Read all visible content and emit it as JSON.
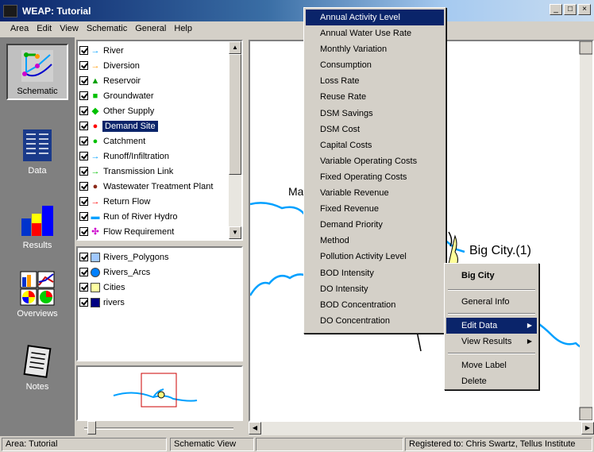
{
  "window": {
    "title": "WEAP: Tutorial",
    "minimize": "_",
    "maximize": "□",
    "close": "×"
  },
  "menubar": [
    "Area",
    "Edit",
    "View",
    "Schematic",
    "General",
    "Help"
  ],
  "leftbar": {
    "schematic": "Schematic",
    "data": "Data",
    "results": "Results",
    "overviews": "Overviews",
    "notes": "Notes"
  },
  "legend": [
    {
      "label": "River",
      "symbol": "→",
      "color": "#00a0ff"
    },
    {
      "label": "Diversion",
      "symbol": "→",
      "color": "#ff9900"
    },
    {
      "label": "Reservoir",
      "symbol": "▲",
      "color": "#00a000"
    },
    {
      "label": "Groundwater",
      "symbol": "■",
      "color": "#00c000"
    },
    {
      "label": "Other Supply",
      "symbol": "◆",
      "color": "#00c000"
    },
    {
      "label": "Demand Site",
      "symbol": "●",
      "color": "#ff0000"
    },
    {
      "label": "Catchment",
      "symbol": "●",
      "color": "#00c000"
    },
    {
      "label": "Runoff/Infiltration",
      "symbol": "→",
      "color": "#00a0ff"
    },
    {
      "label": "Transmission Link",
      "symbol": "→",
      "color": "#00c000"
    },
    {
      "label": "Wastewater Treatment Plant",
      "symbol": "●",
      "color": "#8b2a1a"
    },
    {
      "label": "Return Flow",
      "symbol": "→",
      "color": "#ff0000"
    },
    {
      "label": "Run of River Hydro",
      "symbol": "▬",
      "color": "#00a0ff"
    },
    {
      "label": "Flow Requirement",
      "symbol": "✣",
      "color": "#cc00cc"
    }
  ],
  "layers": [
    {
      "label": "Rivers_Polygons",
      "color": "#a0c8ff"
    },
    {
      "label": "Rivers_Arcs",
      "color": "#0080ff"
    },
    {
      "label": "Cities",
      "color": "#ffffa0"
    },
    {
      "label": "rivers",
      "color": "#000080"
    }
  ],
  "map": {
    "label_ma": "Ma",
    "label_bigcity": "Big City.(1)"
  },
  "editdata_menu": [
    "Annual Activity Level",
    "Annual Water Use Rate",
    "Monthly Variation",
    "Consumption",
    "Loss Rate",
    "Reuse Rate",
    "DSM Savings",
    "DSM Cost",
    "Capital Costs",
    "Variable Operating Costs",
    "Fixed Operating Costs",
    "Variable Revenue",
    "Fixed Revenue",
    "Demand Priority",
    "Method",
    "Pollution Activity Level",
    "BOD Intensity",
    "DO Intensity",
    "BOD Concentration",
    "DO Concentration"
  ],
  "context_menu": {
    "title": "Big City",
    "general_info": "General Info",
    "edit_data": "Edit Data",
    "view_results": "View Results",
    "move_label": "Move Label",
    "delete": "Delete",
    "submenu_arrow": "▶"
  },
  "statusbar": {
    "area": "Area: Tutorial",
    "view": "Schematic View",
    "registered": "Registered to: Chris Swartz, Tellus Institute"
  }
}
